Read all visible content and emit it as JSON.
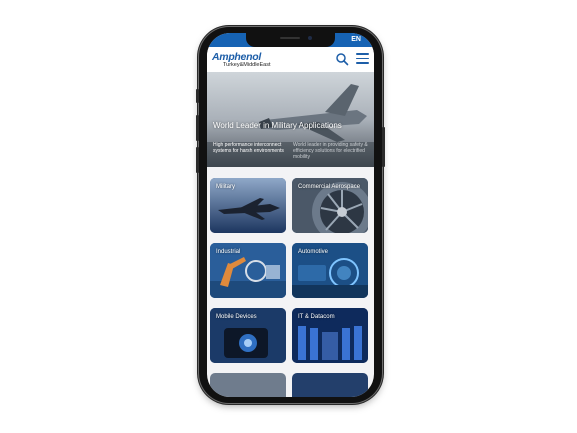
{
  "status_bar": {
    "language": "EN"
  },
  "header": {
    "brand": "Amphenol",
    "region": "Turkey&MiddleEast"
  },
  "hero": {
    "title": "World Leader in Military Applications",
    "text_left": "High performance interconnect systems for harsh environments",
    "text_right": "World leader in providing safety & efficiency solutions for electrified mobility"
  },
  "tiles": [
    {
      "label": "Military"
    },
    {
      "label": "Commercial Aerospace"
    },
    {
      "label": "Industrial"
    },
    {
      "label": "Automotive"
    },
    {
      "label": "Mobile Devices"
    },
    {
      "label": "IT & Datacom"
    }
  ],
  "colors": {
    "brand_blue": "#1d5ea8",
    "status_bar": "#1663b4",
    "tile_dark": "#1a3d73"
  }
}
